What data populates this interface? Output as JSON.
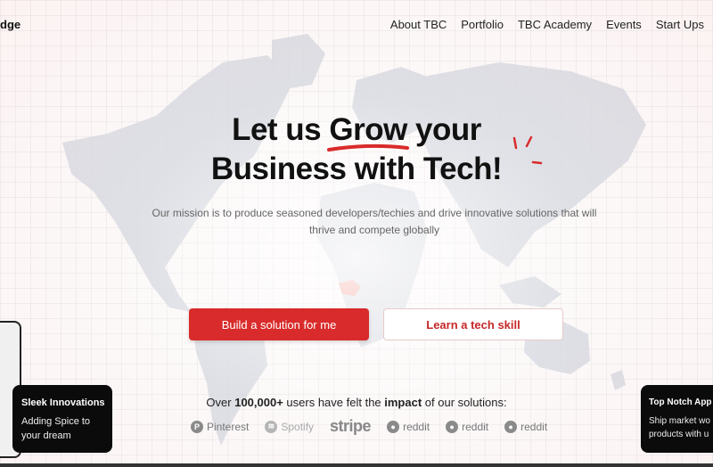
{
  "nav": {
    "logo_text": "dge",
    "links": [
      "About TBC",
      "Portfolio",
      "TBC Academy",
      "Events",
      "Start Ups"
    ]
  },
  "hero": {
    "title_pre": "Let us ",
    "title_highlight": "Grow",
    "title_post": " your",
    "title_line2": "Business with Tech!",
    "mission": "Our mission is to produce seasoned developers/techies and drive innovative solutions that will thrive and compete globally"
  },
  "buttons": {
    "primary": "Build a solution for me",
    "secondary": "Learn a tech skill"
  },
  "users": {
    "pre": "Over ",
    "count": "100,000+",
    "mid": " users have felt the ",
    "bold": "impact",
    "post": " of our solutions:"
  },
  "brands": [
    "Pinterest",
    "Spotify",
    "stripe",
    "reddit",
    "reddit",
    "reddit"
  ],
  "card_left": {
    "title": "Sleek Innovations",
    "desc_line1": "Adding Spice to",
    "desc_line2": "your dream"
  },
  "card_right": {
    "title": "Top Notch App",
    "desc_line1": "Ship market wo",
    "desc_line2": "products with u"
  },
  "colors": {
    "accent": "#d92b2b",
    "map": "#c9ccd6",
    "highlight_country": "#f08a80"
  },
  "icons": [
    "pinterest-icon",
    "spotify-icon",
    "reddit-icon"
  ]
}
